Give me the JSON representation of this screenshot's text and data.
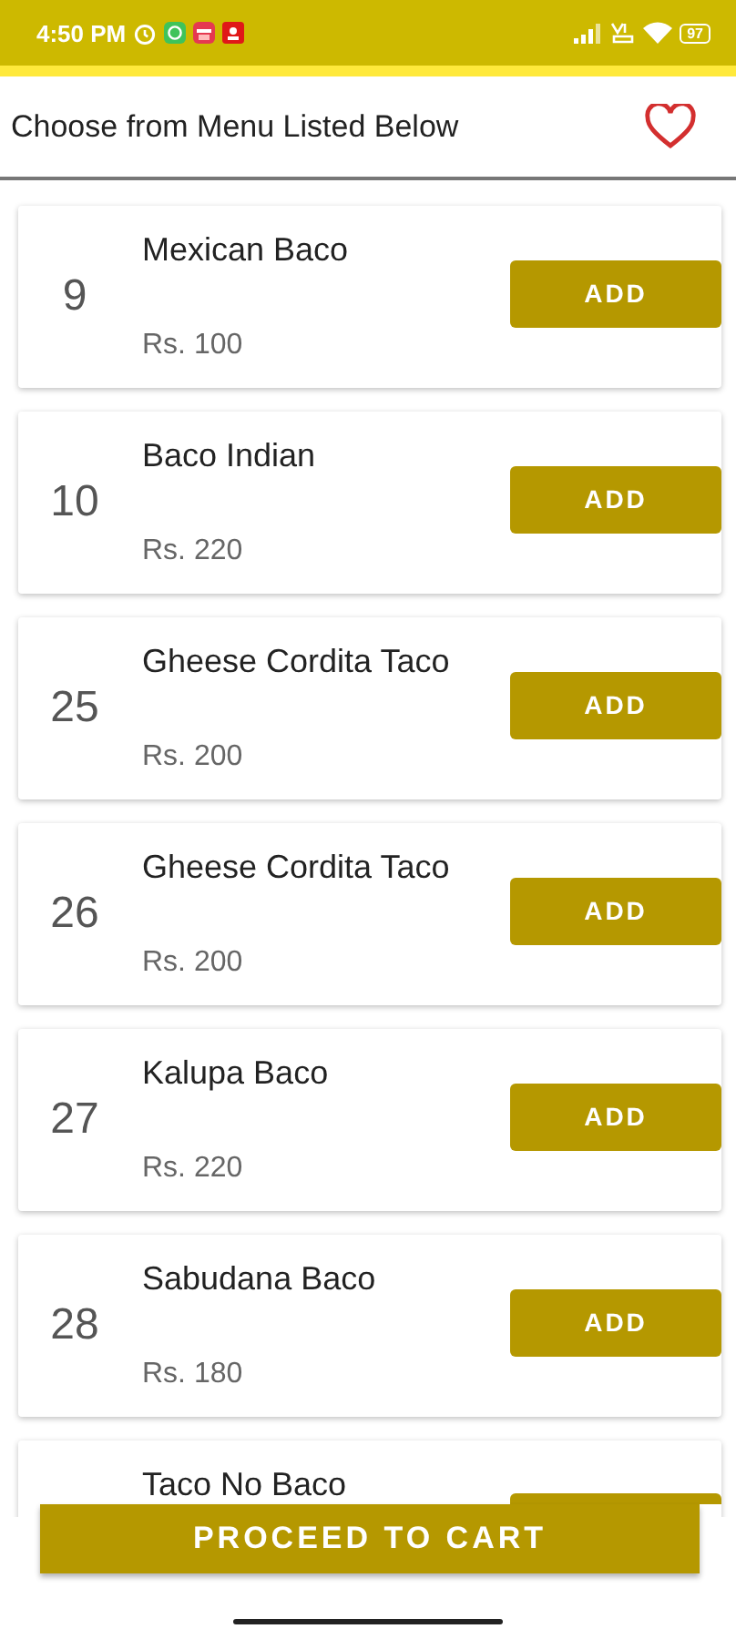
{
  "status_bar": {
    "time": "4:50 PM",
    "battery": "97"
  },
  "header": {
    "title": "Choose from Menu Listed Below"
  },
  "items": [
    {
      "number": "9",
      "name": "Mexican Baco",
      "price": "Rs.  100",
      "action": "ADD"
    },
    {
      "number": "10",
      "name": "Baco Indian",
      "price": "Rs.  220",
      "action": "ADD"
    },
    {
      "number": "25",
      "name": "Gheese Cordita Taco",
      "price": "Rs.  200",
      "action": "ADD"
    },
    {
      "number": "26",
      "name": "Gheese Cordita Taco",
      "price": "Rs.  200",
      "action": "ADD"
    },
    {
      "number": "27",
      "name": "Kalupa Baco",
      "price": "Rs.  220",
      "action": "ADD"
    },
    {
      "number": "28",
      "name": "Sabudana Baco",
      "price": "Rs.  180",
      "action": "ADD"
    },
    {
      "name": "Taco No Baco"
    }
  ],
  "checkout_button": "PROCEED TO CART"
}
